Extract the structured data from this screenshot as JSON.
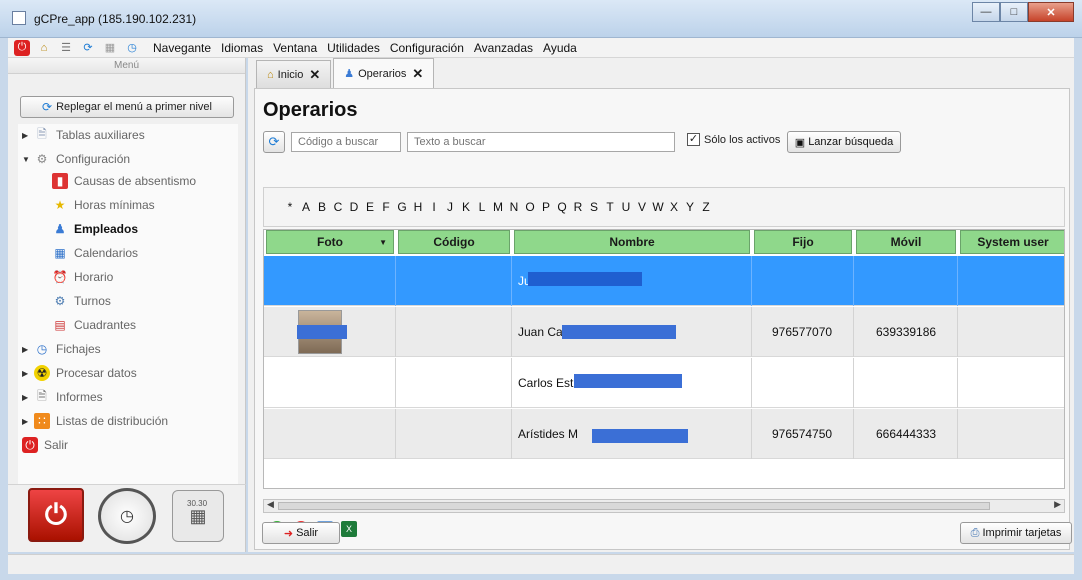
{
  "window": {
    "title": "gCPre_app (185.190.102.231)"
  },
  "menubar": {
    "items": [
      "Navegante",
      "Idiomas",
      "Ventana",
      "Utilidades",
      "Configuración",
      "Avanzadas",
      "Ayuda"
    ]
  },
  "sidebar": {
    "header": "Menú",
    "collapse_button": "Replegar el menú a primer nivel",
    "items": [
      {
        "label": "Tablas auxiliares"
      },
      {
        "label": "Configuración"
      },
      {
        "label": "Causas de absentismo"
      },
      {
        "label": "Horas mínimas"
      },
      {
        "label": "Empleados"
      },
      {
        "label": "Calendarios"
      },
      {
        "label": "Horario"
      },
      {
        "label": "Turnos"
      },
      {
        "label": "Cuadrantes"
      },
      {
        "label": "Fichajes"
      },
      {
        "label": "Procesar datos"
      },
      {
        "label": "Informes"
      },
      {
        "label": "Listas de distribución"
      },
      {
        "label": "Salir"
      }
    ],
    "calc_display": "30.30"
  },
  "tabs": [
    {
      "label": "Inicio"
    },
    {
      "label": "Operarios"
    }
  ],
  "page": {
    "title": "Operarios",
    "code_placeholder": "Código a buscar",
    "text_placeholder": "Texto a buscar",
    "active_only_label": "Sólo los activos",
    "active_only_checked": true,
    "search_button": "Lanzar búsqueda",
    "alphabet": [
      "*",
      "A",
      "B",
      "C",
      "D",
      "E",
      "F",
      "G",
      "H",
      "I",
      "J",
      "K",
      "L",
      "M",
      "N",
      "O",
      "P",
      "Q",
      "R",
      "S",
      "T",
      "U",
      "V",
      "W",
      "X",
      "Y",
      "Z"
    ]
  },
  "table": {
    "columns": [
      "Foto",
      "Código",
      "Nombre",
      "Fijo",
      "Móvil",
      "System user"
    ],
    "rows": [
      {
        "codigo": "",
        "nombre": "Ju",
        "fijo": "",
        "movil": "",
        "system_user": ""
      },
      {
        "codigo": "",
        "nombre": "Juan Car",
        "fijo": "976577070",
        "movil": "639339186",
        "system_user": ""
      },
      {
        "codigo": "",
        "nombre": "Carlos Est",
        "fijo": "",
        "movil": "",
        "system_user": ""
      },
      {
        "codigo": "",
        "nombre": "Arístides M",
        "fijo": "976574750",
        "movil": "666444333",
        "system_user": ""
      }
    ]
  },
  "footer": {
    "exit_button": "Salir",
    "print_button": "Imprimir tarjetas"
  },
  "colors": {
    "header_green": "#8fd88b",
    "selection_blue": "#3399ff"
  }
}
